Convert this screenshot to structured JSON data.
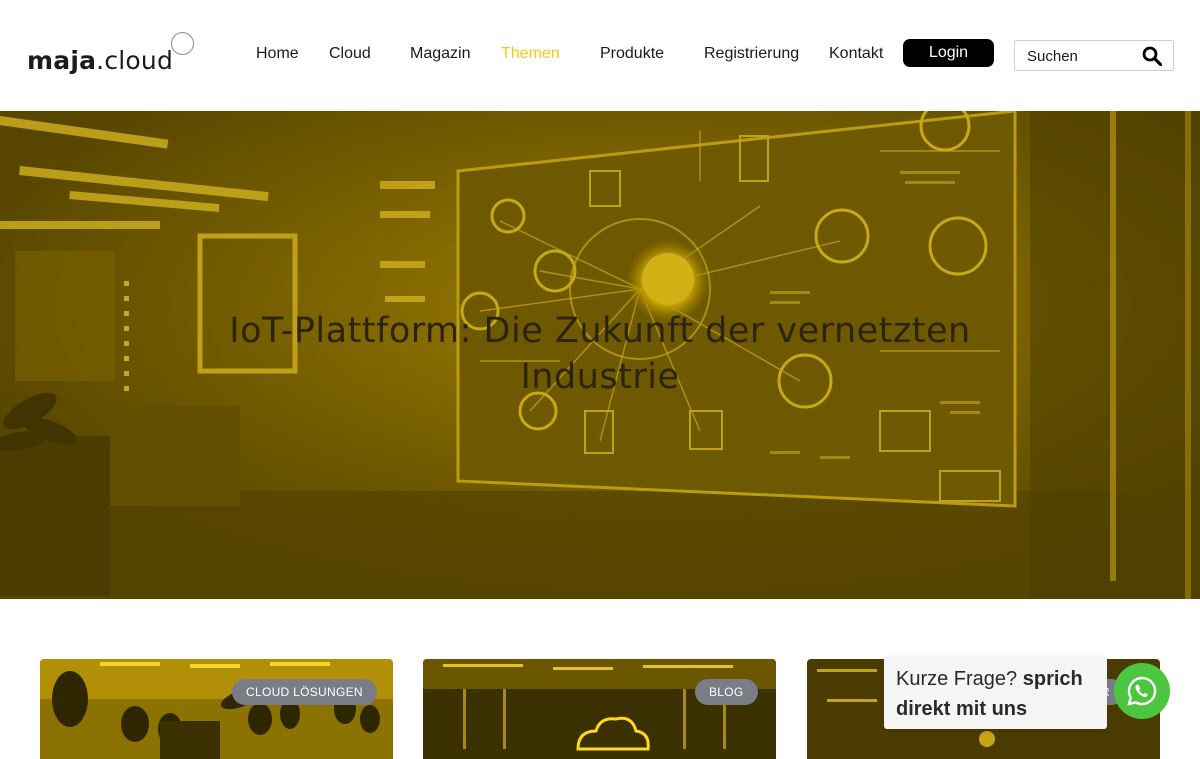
{
  "header": {
    "logo": {
      "bold": "maja",
      "rest": ".cloud"
    },
    "nav": [
      {
        "label": "Home",
        "active": false
      },
      {
        "label": "Cloud",
        "active": false
      },
      {
        "label": "Magazin",
        "active": false
      },
      {
        "label": "Themen",
        "active": true
      },
      {
        "label": "Produkte",
        "active": false
      },
      {
        "label": "Registrierung",
        "active": false
      },
      {
        "label": "Kontakt",
        "active": false
      }
    ],
    "login_label": "Login",
    "search": {
      "placeholder": "Suchen",
      "value": "",
      "icon": "search-icon"
    },
    "accent_color": "#f2c81c"
  },
  "hero": {
    "title": "IoT-Plattform: Die Zukunft der vernetzten Industrie"
  },
  "cards": [
    {
      "badge": "CLOUD LÖSUNGEN"
    },
    {
      "badge": "BLOG"
    },
    {
      "badge": "R"
    }
  ],
  "chat": {
    "text_plain": "Kurze Frage?",
    "text_bold": "sprich direkt mit uns",
    "icon": "whatsapp-icon",
    "color": "#4cc640"
  }
}
